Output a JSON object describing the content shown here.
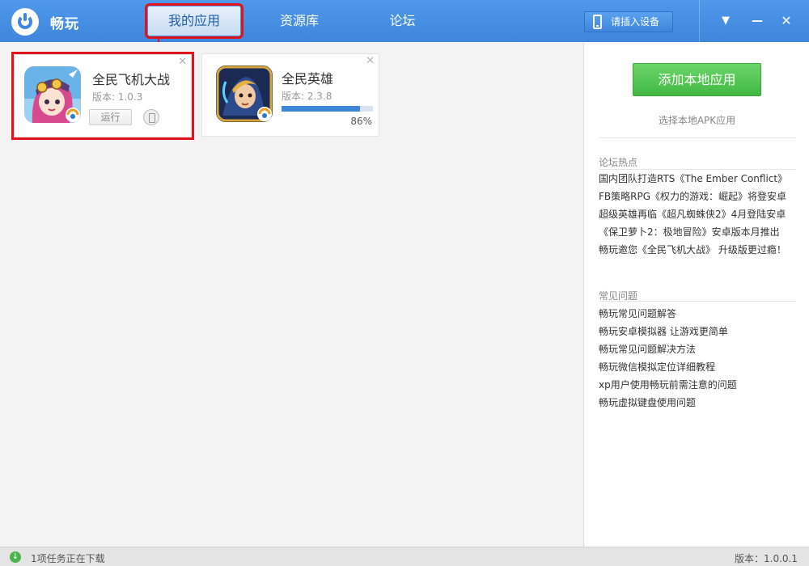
{
  "app": {
    "title": "畅玩"
  },
  "nav": {
    "tabs": [
      "我的应用",
      "资源库",
      "论坛"
    ],
    "active_index": 0
  },
  "device_button": {
    "label": "请插入设备",
    "icon": "phone-icon"
  },
  "window_controls": {
    "menu": "▼",
    "minimize": "—",
    "close": "✕"
  },
  "apps": [
    {
      "name": "全民飞机大战",
      "version": "版本: 1.0.3",
      "action": "运行",
      "icon": "game-icon-plane"
    },
    {
      "name": "全民英雄",
      "version": "版本: 2.3.8",
      "progress": 0.86,
      "progress_text": "86%",
      "icon": "game-icon-hero"
    }
  ],
  "side": {
    "add_button": "添加本地应用",
    "add_hint": "选择本地APK应用",
    "forum_title": "论坛热点",
    "forum_links": [
      "国内团队打造RTS《The Ember Conflict》",
      "FB策略RPG《权力的游戏：崛起》将登安卓",
      "超级英雄再临《超凡蜘蛛侠2》4月登陆安卓",
      "《保卫萝卜2：极地冒险》安卓版本月推出",
      "畅玩邀您《全民飞机大战》 升级版更过瘾！"
    ],
    "faq_title": "常见问题",
    "faq_links": [
      "畅玩常见问题解答",
      "畅玩安卓模拟器 让游戏更简单",
      "畅玩常见问题解决方法",
      "畅玩微信模拟定位详细教程",
      "xp用户使用畅玩前需注意的问题",
      "畅玩虚拟键盘使用问题"
    ]
  },
  "status": {
    "downloading": "1项任务正在下载",
    "version": "版本：1.0.0.1"
  },
  "colors": {
    "topbar": "#3f86dc",
    "accent_green": "#43b943",
    "highlight_red": "#e0141c"
  }
}
